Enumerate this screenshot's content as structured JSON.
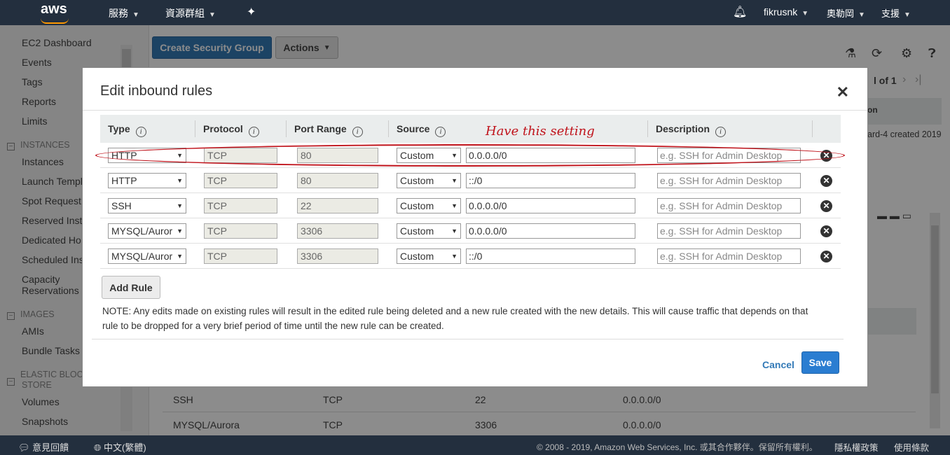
{
  "topnav": {
    "logo": "aws",
    "services": "服務",
    "resource_groups": "資源群組",
    "user": "fikrusnk",
    "region": "奧勒岡",
    "support": "支援"
  },
  "sidebar": {
    "items": [
      {
        "label": "EC2 Dashboard"
      },
      {
        "label": "Events"
      },
      {
        "label": "Tags"
      },
      {
        "label": "Reports"
      },
      {
        "label": "Limits"
      }
    ],
    "instances_header": "INSTANCES",
    "instances": [
      "Instances",
      "Launch Templ",
      "Spot Request",
      "Reserved Inst",
      "Dedicated Ho",
      "Scheduled Ins",
      "Capacity",
      "Reservations"
    ],
    "images_header": "IMAGES",
    "images": [
      "AMIs",
      "Bundle Tasks"
    ],
    "ebs_header_1": "ELASTIC BLOC",
    "ebs_header_2": "STORE",
    "ebs": [
      "Volumes",
      "Snapshots"
    ]
  },
  "main": {
    "create_button": "Create Security Group",
    "actions_button": "Actions",
    "pager": "l of 1",
    "col_partial": "on",
    "row_partial": "ard-4 created 2019",
    "bg_rows": [
      {
        "type": "SSH",
        "protocol": "TCP",
        "port": "22",
        "source": "0.0.0.0/0"
      },
      {
        "type": "MYSQL/Aurora",
        "protocol": "TCP",
        "port": "3306",
        "source": "0.0.0.0/0"
      }
    ]
  },
  "modal": {
    "title": "Edit inbound rules",
    "columns": {
      "type": "Type",
      "protocol": "Protocol",
      "port_range": "Port Range",
      "source": "Source",
      "description": "Description"
    },
    "annotation": "Have this setting",
    "description_placeholder": "e.g. SSH for Admin Desktop",
    "rules": [
      {
        "type": "HTTP",
        "protocol": "TCP",
        "port": "80",
        "source_type": "Custom",
        "source": "0.0.0.0/0"
      },
      {
        "type": "HTTP",
        "protocol": "TCP",
        "port": "80",
        "source_type": "Custom",
        "source": "::/0"
      },
      {
        "type": "SSH",
        "protocol": "TCP",
        "port": "22",
        "source_type": "Custom",
        "source": "0.0.0.0/0"
      },
      {
        "type": "MYSQL/Auror",
        "protocol": "TCP",
        "port": "3306",
        "source_type": "Custom",
        "source": "0.0.0.0/0"
      },
      {
        "type": "MYSQL/Auror",
        "protocol": "TCP",
        "port": "3306",
        "source_type": "Custom",
        "source": "::/0"
      }
    ],
    "add_rule": "Add Rule",
    "note": "NOTE: Any edits made on existing rules will result in the edited rule being deleted and a new rule created with the new details. This will cause traffic that depends on that rule to be dropped for a very brief period of time until the new rule can be created.",
    "cancel": "Cancel",
    "save": "Save"
  },
  "bottombar": {
    "feedback": "意見回饋",
    "language": "中文(繁體)",
    "copyright": "© 2008 - 2019, Amazon Web Services, Inc. 或其合作夥伴。保留所有權利。",
    "privacy": "隱私權政策",
    "terms": "使用條款"
  }
}
